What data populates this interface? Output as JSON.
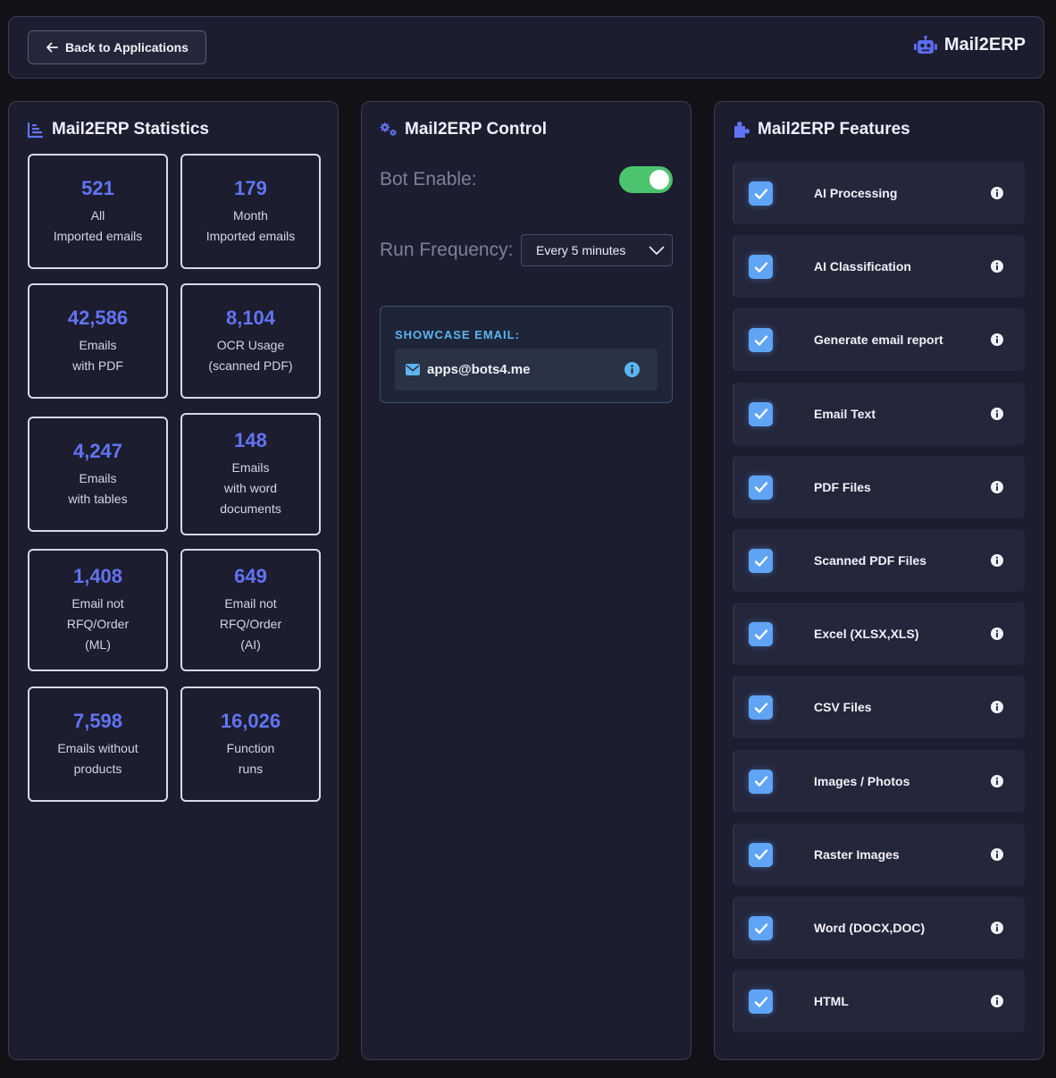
{
  "header": {
    "back_label": "Back to Applications",
    "brand": "Mail2ERP"
  },
  "stats": {
    "title": "Mail2ERP Statistics",
    "items": [
      {
        "value": "521",
        "label": "All\nImported emails"
      },
      {
        "value": "179",
        "label": "Month\nImported emails"
      },
      {
        "value": "42,586",
        "label": "Emails\nwith PDF"
      },
      {
        "value": "8,104",
        "label": "OCR Usage\n(scanned PDF)"
      },
      {
        "value": "4,247",
        "label": "Emails\nwith tables"
      },
      {
        "value": "148",
        "label": "Emails\nwith word\ndocuments"
      },
      {
        "value": "1,408",
        "label": "Email not\nRFQ/Order\n(ML)"
      },
      {
        "value": "649",
        "label": "Email not\nRFQ/Order\n(AI)"
      },
      {
        "value": "7,598",
        "label": "Emails without\nproducts"
      },
      {
        "value": "16,026",
        "label": "Function\nruns"
      }
    ]
  },
  "control": {
    "title": "Mail2ERP Control",
    "bot_enable_label": "Bot Enable:",
    "bot_enabled": true,
    "run_frequency_label": "Run Frequency:",
    "run_frequency_value": "Every 5 minutes",
    "showcase_caption": "SHOWCASE EMAIL:",
    "showcase_email": "apps@bots4.me"
  },
  "features": {
    "title": "Mail2ERP Features",
    "items": [
      {
        "name": "AI Processing",
        "checked": true
      },
      {
        "name": "AI Classification",
        "checked": true
      },
      {
        "name": "Generate email report",
        "checked": true
      },
      {
        "name": "Email Text",
        "checked": true
      },
      {
        "name": "PDF Files",
        "checked": true
      },
      {
        "name": "Scanned PDF Files",
        "checked": true
      },
      {
        "name": "Excel (XLSX,XLS)",
        "checked": true
      },
      {
        "name": "CSV Files",
        "checked": true
      },
      {
        "name": "Images / Photos",
        "checked": true
      },
      {
        "name": "Raster Images",
        "checked": true
      },
      {
        "name": "Word (DOCX,DOC)",
        "checked": true
      },
      {
        "name": "HTML",
        "checked": true
      }
    ]
  },
  "colors": {
    "accent": "#6274f5",
    "toggle_on": "#4cc46d",
    "checkbox": "#5fa4f5",
    "showcase_caption": "#5cb5ef"
  }
}
